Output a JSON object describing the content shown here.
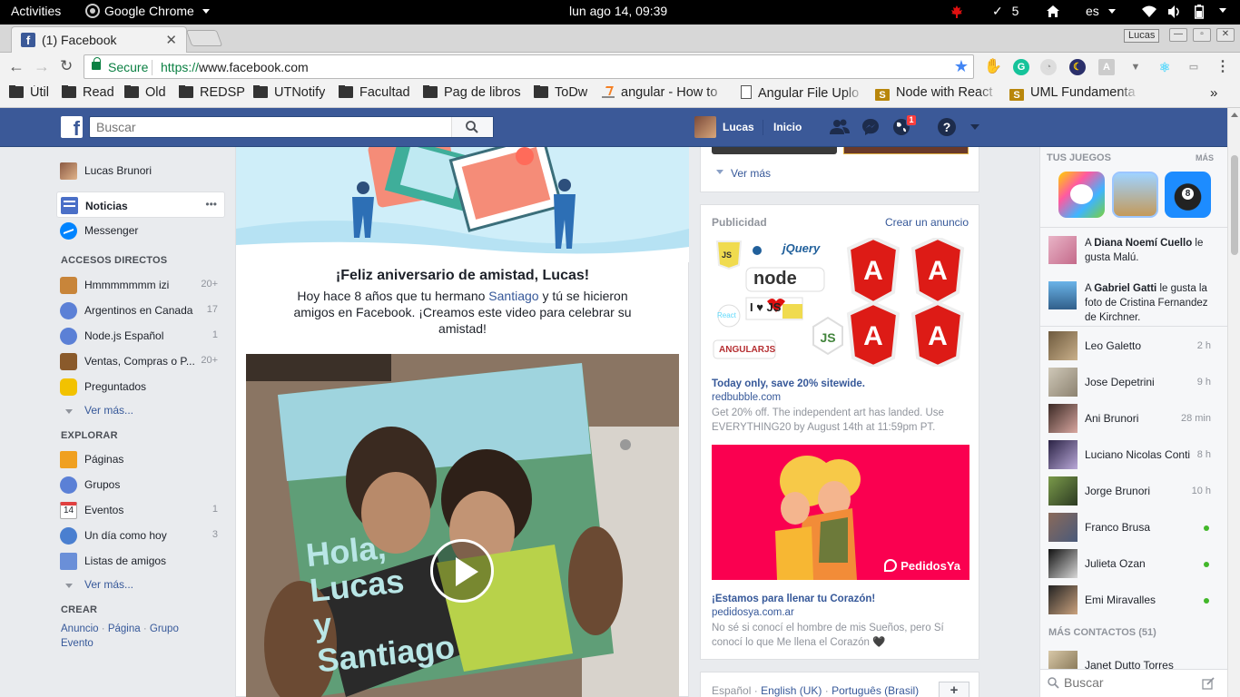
{
  "system_bar": {
    "activities": "Activities",
    "app": "Google Chrome",
    "clock": "lun ago 14, 09:39",
    "task_count": "5",
    "language": "es"
  },
  "browser": {
    "tab_title": "(1) Facebook",
    "secure_label": "Secure",
    "url_protocol": "https://",
    "url_host": "www.facebook.com",
    "profile_chip": "Lucas",
    "bookmarks": [
      {
        "label": "Útil",
        "icon": "folder-icon"
      },
      {
        "label": "Read",
        "icon": "folder-icon"
      },
      {
        "label": "Old",
        "icon": "folder-icon"
      },
      {
        "label": "REDSP",
        "icon": "folder-icon"
      },
      {
        "label": "UTNotify",
        "icon": "folder-icon"
      },
      {
        "label": "Facultad",
        "icon": "folder-icon"
      },
      {
        "label": "Pag de libros",
        "icon": "folder-icon"
      },
      {
        "label": "ToDw",
        "icon": "folder-icon"
      },
      {
        "label": "angular - How to",
        "icon": "stackoverflow-icon"
      },
      {
        "label": "Angular File Uplo",
        "icon": "page-icon"
      },
      {
        "label": "Node with React",
        "icon": "s-icon"
      },
      {
        "label": "UML Fundamenta",
        "icon": "s-icon"
      }
    ],
    "overflow": "»"
  },
  "fb_header": {
    "search_placeholder": "Buscar",
    "user": "Lucas",
    "home": "Inicio",
    "notifications_count": "1",
    "help": "?"
  },
  "left_nav": {
    "profile": "Lucas Brunori",
    "noticias": "Noticias",
    "more_dots": "•••",
    "messenger": "Messenger",
    "shortcuts_head": "ACCESOS DIRECTOS",
    "shortcuts": [
      {
        "label": "Hmmmmmmm izi",
        "count": "20+",
        "color": "#c8853a"
      },
      {
        "label": "Argentinos en Canada",
        "count": "17",
        "color": "#5b80d6"
      },
      {
        "label": "Node.js Español",
        "count": "1",
        "color": "#5b80d6"
      },
      {
        "label": "Ventas, Compras o P...",
        "count": "20+",
        "color": "#8a5a2b"
      },
      {
        "label": "Preguntados",
        "count": "",
        "color": "#f2c200"
      }
    ],
    "see_more_1": "Ver más...",
    "explore_head": "EXPLORAR",
    "explore": [
      {
        "label": "Páginas",
        "count": "",
        "color": "#f0a020"
      },
      {
        "label": "Grupos",
        "count": "",
        "color": "#5b80d6"
      },
      {
        "label": "Eventos",
        "count": "1",
        "color": "#e04040"
      },
      {
        "label": "Un día como hoy",
        "count": "3",
        "color": "#4a7fd0"
      },
      {
        "label": "Listas de amigos",
        "count": "",
        "color": "#6a8fd8"
      }
    ],
    "calendar_day": "14",
    "see_more_2": "Ver más...",
    "create_head": "CREAR",
    "create_links": [
      "Anuncio",
      "Página",
      "Grupo",
      "Evento"
    ],
    "create_sep": "·"
  },
  "story": {
    "title": "¡Feliz aniversario de amistad, Lucas!",
    "body_before": "Hoy hace 8 años que tu hermano ",
    "body_link": "Santiago",
    "body_after": " y tú se hicieron amigos en Facebook. ¡Creamos este video para celebrar su amistad!",
    "video_text": [
      "Hola,",
      "Lucas",
      "y",
      "Santiago"
    ]
  },
  "right_col": {
    "see_more": "Ver más",
    "ads_head": "Publicidad",
    "create_ad": "Crear un anuncio",
    "ad1": {
      "title": "Today only, save 20% sitewide.",
      "domain": "redbubble.com",
      "text": "Get 20% off. The independent art has landed. Use EVERYTHING20 by August 14th at 11:59pm PT.",
      "stickers": [
        "jQuery",
        "node",
        "React",
        "I ♥ JS",
        "ANGULARJS",
        "JS"
      ]
    },
    "ad2": {
      "brand": "PedidosYa",
      "title": "¡Estamos para llenar tu Corazón!",
      "domain": "pedidosya.com.ar",
      "text": "No sé si conocí el hombre de mis Sueños, pero Sí conocí lo que Me llena el Corazón 🖤"
    },
    "languages": [
      "Español",
      "English (UK)",
      "Português (Brasil)"
    ],
    "lang_sep": "·",
    "add_language": "+"
  },
  "chat": {
    "games_head": "TUS JUEGOS",
    "games_more": "MÁS",
    "ticker": [
      {
        "name": "Diana Noemí Cuello",
        "before": "A ",
        "after": " le gusta Malú."
      },
      {
        "name": "Gabriel Gatti",
        "before": "A ",
        "after": " le gusta la foto de Cristina Fernandez de Kirchner."
      }
    ],
    "contacts": [
      {
        "name": "Leo Galetto",
        "time": "2 h",
        "online": false
      },
      {
        "name": "Jose Depetrini",
        "time": "9 h",
        "online": false
      },
      {
        "name": "Ani Brunori",
        "time": "28 min",
        "online": false
      },
      {
        "name": "Luciano Nicolas Conti",
        "time": "8 h",
        "online": false
      },
      {
        "name": "Jorge Brunori",
        "time": "10 h",
        "online": false
      },
      {
        "name": "Franco Brusa",
        "time": "",
        "online": true
      },
      {
        "name": "Julieta Ozan",
        "time": "",
        "online": true
      },
      {
        "name": "Emi Miravalles",
        "time": "",
        "online": true
      }
    ],
    "more_contacts": "MÁS CONTACTOS (51)",
    "extra_contact": "Janet Dutto Torres",
    "search_placeholder": "Buscar"
  }
}
